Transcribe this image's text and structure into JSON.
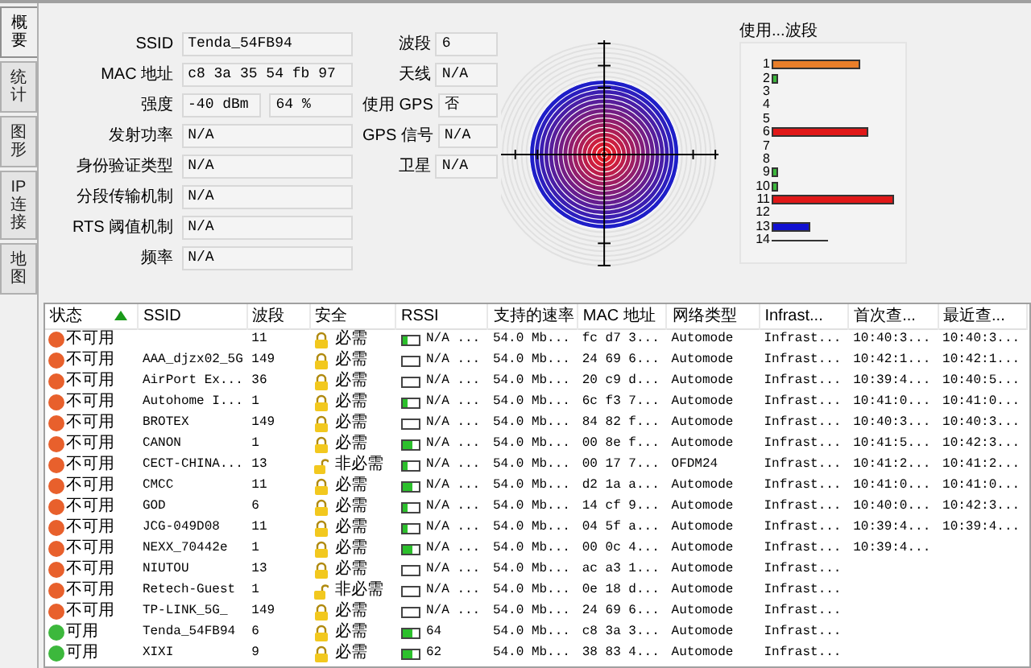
{
  "tabs": [
    {
      "label": "概要",
      "selected": true
    },
    {
      "label": "统计",
      "selected": false
    },
    {
      "label": "图形",
      "selected": false
    },
    {
      "label": "IP 连接",
      "selected": false
    },
    {
      "label": "地图",
      "selected": false
    }
  ],
  "details": [
    {
      "label": "SSID",
      "values": [
        "Tenda_54FB94"
      ]
    },
    {
      "label": "MAC 地址",
      "values": [
        "c8 3a 35 54 fb 97"
      ]
    },
    {
      "label": "强度",
      "values": [
        "-40 dBm",
        "64 %"
      ]
    },
    {
      "label": "发射功率",
      "values": [
        "N/A"
      ]
    },
    {
      "label": "身份验证类型",
      "values": [
        "N/A"
      ]
    },
    {
      "label": "分段传输机制",
      "values": [
        "N/A"
      ]
    },
    {
      "label": "RTS 阈值机制",
      "values": [
        "N/A"
      ]
    },
    {
      "label": "频率",
      "values": [
        "N/A"
      ]
    }
  ],
  "side_details": [
    {
      "label": "波段",
      "value": "6"
    },
    {
      "label": "天线",
      "value": "N/A"
    },
    {
      "label": "使用 GPS",
      "value": "否"
    },
    {
      "label": "GPS 信号",
      "value": "N/A"
    },
    {
      "label": "卫星",
      "value": "N/A"
    }
  ],
  "channel_chart": {
    "title": "使用...波段",
    "labels": [
      "1",
      "2",
      "3",
      "4",
      "5",
      "6",
      "7",
      "8",
      "9",
      "10",
      "11",
      "12",
      "13",
      "14"
    ]
  },
  "table": {
    "columns": [
      {
        "label": "状态",
        "sorted": true
      },
      {
        "label": "SSID",
        "sorted": false
      },
      {
        "label": "波段",
        "sorted": false
      },
      {
        "label": "安全",
        "sorted": false
      },
      {
        "label": "RSSI",
        "sorted": false
      },
      {
        "label": "支持的速率",
        "sorted": false
      },
      {
        "label": "MAC 地址",
        "sorted": false
      },
      {
        "label": "网络类型",
        "sorted": false
      },
      {
        "label": "Infrast...",
        "sorted": false
      },
      {
        "label": "首次查...",
        "sorted": false
      },
      {
        "label": "最近查...",
        "sorted": false
      }
    ],
    "rows": [
      {
        "status": "不可用",
        "color": "#e8602c",
        "channel": "11",
        "secured": true,
        "security": "必需",
        "level": 0.3,
        "rssi": "N/A ...",
        "rate": "54.0 Mb...",
        "mac": "fc d7 3...",
        "net_type": "Automode",
        "infra": "Infrast...",
        "first": "10:40:3...",
        "last": "10:40:3..."
      },
      {
        "status": "不可用",
        "color": "#e8602c",
        "ssid": "AAA_djzx02_5G",
        "channel": "149",
        "secured": true,
        "security": "必需",
        "level": 0,
        "rssi": "N/A ...",
        "rate": "54.0 Mb...",
        "mac": "24 69 6...",
        "net_type": "Automode",
        "infra": "Infrast...",
        "first": "10:42:1...",
        "last": "10:42:1..."
      },
      {
        "status": "不可用",
        "color": "#e8602c",
        "ssid": "AirPort Ex...",
        "channel": "36",
        "secured": true,
        "security": "必需",
        "level": 0,
        "rssi": "N/A ...",
        "rate": "54.0 Mb...",
        "mac": "20 c9 d...",
        "net_type": "Automode",
        "infra": "Infrast...",
        "first": "10:39:4...",
        "last": "10:40:5..."
      },
      {
        "status": "不可用",
        "color": "#e8602c",
        "ssid": "Autohome I...",
        "channel": "1",
        "secured": true,
        "security": "必需",
        "level": 0.3,
        "rssi": "N/A ...",
        "rate": "54.0 Mb...",
        "mac": "6c f3 7...",
        "net_type": "Automode",
        "infra": "Infrast...",
        "first": "10:41:0...",
        "last": "10:41:0..."
      },
      {
        "status": "不可用",
        "color": "#e8602c",
        "ssid": "BROTEX",
        "channel": "149",
        "secured": true,
        "security": "必需",
        "level": 0,
        "rssi": "N/A ...",
        "rate": "54.0 Mb...",
        "mac": "84 82 f...",
        "net_type": "Automode",
        "infra": "Infrast...",
        "first": "10:40:3...",
        "last": "10:40:3..."
      },
      {
        "status": "不可用",
        "color": "#e8602c",
        "ssid": "CANON",
        "channel": "1",
        "secured": true,
        "security": "必需",
        "level": 0.6,
        "rssi": "N/A ...",
        "rate": "54.0 Mb...",
        "mac": "00 8e f...",
        "net_type": "Automode",
        "infra": "Infrast...",
        "first": "10:41:5...",
        "last": "10:42:3..."
      },
      {
        "status": "不可用",
        "color": "#e8602c",
        "ssid": "CECT-CHINA...",
        "channel": "13",
        "secured": false,
        "security": "非必需",
        "level": 0.3,
        "rssi": "N/A ...",
        "rate": "54.0 Mb...",
        "mac": "00 17 7...",
        "net_type": "OFDM24",
        "infra": "Infrast...",
        "first": "10:41:2...",
        "last": "10:41:2..."
      },
      {
        "status": "不可用",
        "color": "#e8602c",
        "ssid": "CMCC",
        "channel": "11",
        "secured": true,
        "security": "必需",
        "level": 0.6,
        "rssi": "N/A ...",
        "rate": "54.0 Mb...",
        "mac": "d2 1a a...",
        "net_type": "Automode",
        "infra": "Infrast...",
        "first": "10:41:0...",
        "last": "10:41:0..."
      },
      {
        "status": "不可用",
        "color": "#e8602c",
        "ssid": "GOD",
        "channel": "6",
        "secured": true,
        "security": "必需",
        "level": 0.3,
        "rssi": "N/A ...",
        "rate": "54.0 Mb...",
        "mac": "14 cf 9...",
        "net_type": "Automode",
        "infra": "Infrast...",
        "first": "10:40:0...",
        "last": "10:42:3..."
      },
      {
        "status": "不可用",
        "color": "#e8602c",
        "ssid": "JCG-049D08",
        "channel": "11",
        "secured": true,
        "security": "必需",
        "level": 0.3,
        "rssi": "N/A ...",
        "rate": "54.0 Mb...",
        "mac": "04 5f a...",
        "net_type": "Automode",
        "infra": "Infrast...",
        "first": "10:39:4...",
        "last": "10:39:4..."
      },
      {
        "status": "不可用",
        "color": "#e8602c",
        "ssid": "NEXX_70442e",
        "channel": "1",
        "secured": true,
        "security": "必需",
        "level": 0.6,
        "rssi": "N/A ...",
        "rate": "54.0 Mb...",
        "mac": "00 0c 4...",
        "net_type": "Automode",
        "infra": "Infrast...",
        "first": "10:39:4..."
      },
      {
        "status": "不可用",
        "color": "#e8602c",
        "ssid": "NIUTOU",
        "channel": "13",
        "secured": true,
        "security": "必需",
        "level": 0,
        "rssi": "N/A ...",
        "rate": "54.0 Mb...",
        "mac": "ac a3 1...",
        "net_type": "Automode",
        "infra": "Infrast..."
      },
      {
        "status": "不可用",
        "color": "#e8602c",
        "ssid": "Retech-Guest",
        "channel": "1",
        "secured": false,
        "security": "非必需",
        "level": 0,
        "rssi": "N/A ...",
        "rate": "54.0 Mb...",
        "mac": "0e 18 d...",
        "net_type": "Automode",
        "infra": "Infrast..."
      },
      {
        "status": "不可用",
        "color": "#e8602c",
        "ssid": "TP-LINK_5G_",
        "channel": "149",
        "secured": true,
        "security": "必需",
        "level": 0,
        "rssi": "N/A ...",
        "rate": "54.0 Mb...",
        "mac": "24 69 6...",
        "net_type": "Automode",
        "infra": "Infrast..."
      },
      {
        "status": "可用",
        "color": "#3cb83c",
        "ssid": "Tenda_54FB94",
        "channel": "6",
        "secured": true,
        "security": "必需",
        "level": 0.6,
        "rssi": "64",
        "rate": "54.0 Mb...",
        "mac": "c8 3a 3...",
        "net_type": "Automode",
        "infra": "Infrast..."
      },
      {
        "status": "可用",
        "color": "#3cb83c",
        "ssid": "XIXI",
        "channel": "9",
        "secured": true,
        "security": "必需",
        "level": 0.6,
        "rssi": "62",
        "rate": "54.0 Mb...",
        "mac": "38 83 4...",
        "net_type": "Automode",
        "infra": "Infrast..."
      }
    ]
  }
}
